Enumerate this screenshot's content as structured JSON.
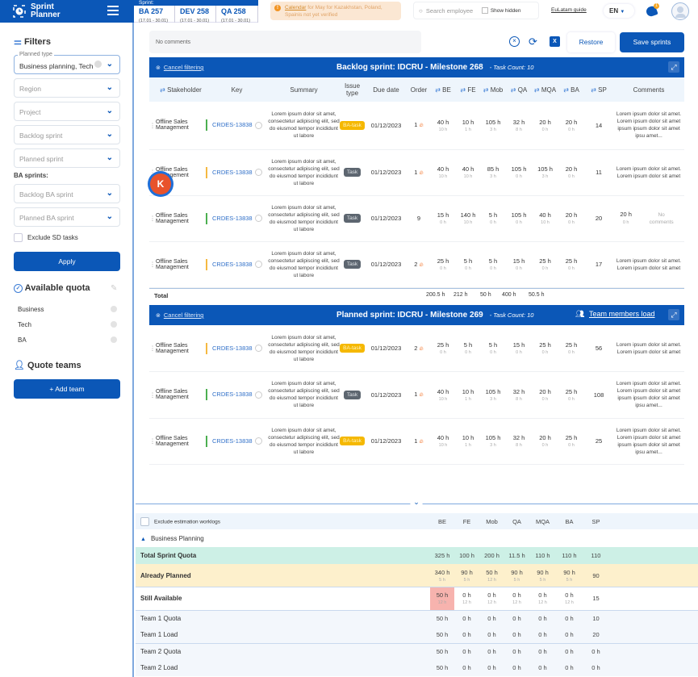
{
  "app": {
    "title_line1": "Sprint",
    "title_line2": "Planner"
  },
  "sprint_tabs": {
    "label": "Sprint:",
    "tabs": [
      {
        "name": "BA 257",
        "dates": "(17.01 - 30.01)"
      },
      {
        "name": "DEV 258",
        "dates": "(17.01 - 30.01)"
      },
      {
        "name": "QA 258",
        "dates": "(17.01 - 30.01)"
      }
    ]
  },
  "alert": {
    "link": "Calendar",
    "text": " for May for Kazakhstan, Poland, Spainis not yet verified"
  },
  "topbar": {
    "search_placeholder": "Search employee",
    "show_hidden": "Show hidden",
    "guide": "EuLatam guide",
    "lang": "EN",
    "bell_count": "1"
  },
  "sidebar": {
    "filters_title": "Filters",
    "planned_type_label": "Planned type",
    "planned_type_value": "Business planning, Tech",
    "region": "Region",
    "project": "Project",
    "backlog_sprint": "Backlog sprint",
    "planned_sprint": "Planned sprint",
    "ba_sprints": "BA sprints:",
    "backlog_ba": "Backlog BA sprint",
    "planned_ba": "Planned BA sprint",
    "exclude_sd": "Exclude SD tasks",
    "apply": "Apply",
    "quota_title": "Available quota",
    "quota_items": [
      "Business",
      "Tech",
      "BA"
    ],
    "teams_title": "Quote teams",
    "add_team": "+ Add team"
  },
  "toolbar": {
    "comments": "No comments",
    "restore": "Restore",
    "save": "Save sprints"
  },
  "columns": [
    "Stakeholder",
    "Key",
    "Summary",
    "Issue type",
    "Due date",
    "Order",
    "BE",
    "FE",
    "Mob",
    "QA",
    "MQA",
    "BA",
    "SP",
    "Comments"
  ],
  "colors": {
    "brand": "#0b57b7",
    "green": "#4caf50",
    "orange": "#f5b942"
  },
  "backlog": {
    "cancel": "Cancel filtering",
    "title": "Backlog sprint: IDCRU - Milestone 268",
    "task_count": "- Task Count: 10",
    "rows": [
      {
        "stakeholder": "Offline Sales Management",
        "key": "CRDES-13838",
        "bar": "green",
        "summary": "Lorem ipsum dolor sit amet, consectetur adipiscing elit, sed do eiusmod tempor incididunt ut labore",
        "type": "BA-task",
        "due": "01/12/2023",
        "order": "1",
        "fire": true,
        "h": [
          [
            "40 h",
            "10 h"
          ],
          [
            "10 h",
            "1 h"
          ],
          [
            "105 h",
            "3 h"
          ],
          [
            "32 h",
            "8 h"
          ],
          [
            "20 h",
            "0 h"
          ],
          [
            "20 h",
            "0 h"
          ]
        ],
        "sp": "14",
        "comment": "Lorem ipsum dolor sit amet. Lorem ipsum dolor sit amet  ipsum ipsum dolor sit amet ipsu amet..."
      },
      {
        "stakeholder": "Offline Sales Management",
        "key": "CRDES-13838",
        "bar": "orange",
        "summary": "Lorem ipsum dolor sit amet, consectetur adipiscing elit, sed do eiusmod tempor incididunt ut labore",
        "type": "Task",
        "due": "01/12/2023",
        "order": "1",
        "fire": true,
        "h": [
          [
            "40 h",
            "10 h"
          ],
          [
            "40 h",
            "10 h"
          ],
          [
            "85 h",
            "3 h"
          ],
          [
            "105 h",
            "0 h"
          ],
          [
            "105 h",
            "3 h"
          ],
          [
            "20 h",
            "0 h"
          ]
        ],
        "sp": "11",
        "comment": "Lorem ipsum dolor sit amet. Lorem ipsum dolor sit amet"
      },
      {
        "stakeholder": "Offline Sales Management",
        "key": "CRDES-13838",
        "bar": "green",
        "summary": "Lorem ipsum dolor sit amet, consectetur adipiscing elit, sed do eiusmod tempor incididunt ut labore",
        "type": "Task",
        "due": "01/12/2023",
        "order": "9",
        "fire": false,
        "h": [
          [
            "15 h",
            "0 h"
          ],
          [
            "140 h",
            "10 h"
          ],
          [
            "5 h",
            "0 h"
          ],
          [
            "105 h",
            "0 h"
          ],
          [
            "40 h",
            "10 h"
          ],
          [
            "20 h",
            "0 h"
          ]
        ],
        "sp": "20",
        "extra": [
          "20 h",
          "0 h"
        ],
        "comment": "No comments"
      },
      {
        "stakeholder": "Offline Sales Management",
        "key": "CRDES-13838",
        "bar": "orange",
        "summary": "Lorem ipsum dolor sit amet, consectetur adipiscing elit, sed do eiusmod tempor incididunt ut labore",
        "type": "Task",
        "due": "01/12/2023",
        "order": "2",
        "fire": true,
        "h": [
          [
            "25 h",
            "0 h"
          ],
          [
            "5 h",
            "0 h"
          ],
          [
            "5 h",
            "0 h"
          ],
          [
            "15 h",
            "0 h"
          ],
          [
            "25 h",
            "0 h"
          ],
          [
            "25 h",
            "0 h"
          ]
        ],
        "sp": "17",
        "comment": "Lorem ipsum dolor sit amet. Lorem ipsum dolor sit amet"
      }
    ],
    "total_label": "Total",
    "totals": [
      "200.5 h",
      "212 h",
      "50 h",
      "400 h",
      "50.5 h"
    ]
  },
  "planned": {
    "cancel": "Cancel filtering",
    "title": "Planned sprint: IDCRU - Milestone 269",
    "task_count": "- Task Count: 10",
    "team_load": "Team members load",
    "rows": [
      {
        "stakeholder": "Offline Sales Management",
        "key": "CRDES-13838",
        "bar": "orange",
        "summary": "Lorem ipsum dolor sit amet, consectetur adipiscing elit, sed do eiusmod tempor incididunt ut labore",
        "type": "BA-task",
        "due": "01/12/2023",
        "order": "2",
        "fire": true,
        "h": [
          [
            "25 h",
            "0 h"
          ],
          [
            "5 h",
            "0 h"
          ],
          [
            "5 h",
            "0 h"
          ],
          [
            "15 h",
            "0 h"
          ],
          [
            "25 h",
            "0 h"
          ],
          [
            "25 h",
            "0 h"
          ]
        ],
        "sp": "56",
        "comment": "Lorem ipsum dolor sit amet. Lorem ipsum dolor sit amet"
      },
      {
        "stakeholder": "Offline Sales Management",
        "key": "CRDES-13838",
        "bar": "green",
        "summary": "Lorem ipsum dolor sit amet, consectetur adipiscing elit, sed do eiusmod tempor incididunt ut labore",
        "type": "Task",
        "due": "01/12/2023",
        "order": "1",
        "fire": true,
        "h": [
          [
            "40 h",
            "10 h"
          ],
          [
            "10 h",
            "1 h"
          ],
          [
            "105 h",
            "3 h"
          ],
          [
            "32 h",
            "8 h"
          ],
          [
            "20 h",
            "0 h"
          ],
          [
            "25 h",
            "0 h"
          ]
        ],
        "sp": "108",
        "comment": "Lorem ipsum dolor sit amet. Lorem ipsum dolor sit amet  ipsum ipsum dolor sit amet ipsu amet..."
      },
      {
        "stakeholder": "Offline Sales Management",
        "key": "CRDES-13838",
        "bar": "green",
        "summary": "Lorem ipsum dolor sit amet, consectetur adipiscing elit, sed do eiusmod tempor incididunt ut labore",
        "type": "BA-task",
        "due": "01/12/2023",
        "order": "1",
        "fire": true,
        "h": [
          [
            "40 h",
            "10 h"
          ],
          [
            "10 h",
            "1 h"
          ],
          [
            "105 h",
            "3 h"
          ],
          [
            "32 h",
            "8 h"
          ],
          [
            "20 h",
            "0 h"
          ],
          [
            "25 h",
            "0 h"
          ]
        ],
        "sp": "25",
        "comment": "Lorem ipsum dolor sit amet. Lorem ipsum dolor sit amet  ipsum ipsum dolor sit amet ipsu amet..."
      }
    ]
  },
  "quota": {
    "exclude": "Exclude estimation worklogs",
    "columns": [
      "BE",
      "FE",
      "Mob",
      "QA",
      "MQA",
      "BA",
      "SP"
    ],
    "group": "Business Planning",
    "rows": [
      {
        "label": "Total Sprint Quota",
        "style": "green",
        "cells": [
          [
            "325 h"
          ],
          [
            "100 h"
          ],
          [
            "200 h"
          ],
          [
            "11.5 h"
          ],
          [
            "110 h"
          ],
          [
            "110 h"
          ],
          [
            "110"
          ]
        ]
      },
      {
        "label": "Already Planned",
        "style": "yellow",
        "cells": [
          [
            "340 h",
            "5 h"
          ],
          [
            "90 h",
            "5 h"
          ],
          [
            "50 h",
            "12 h"
          ],
          [
            "90 h",
            "5 h"
          ],
          [
            "90 h",
            "5 h"
          ],
          [
            "90 h",
            "5 h"
          ],
          [
            "90"
          ]
        ]
      },
      {
        "label": "Still Available",
        "style": "white",
        "over": [
          0
        ],
        "cells": [
          [
            "50 h",
            "12 h"
          ],
          [
            "0 h",
            "12 h"
          ],
          [
            "0 h",
            "12 h"
          ],
          [
            "0 h",
            "12 h"
          ],
          [
            "0 h",
            "12 h"
          ],
          [
            "0 h",
            "12 h"
          ],
          [
            "15"
          ]
        ]
      },
      {
        "label": "Team 1 Quota",
        "style": "team",
        "cells": [
          [
            "50 h"
          ],
          [
            "0 h"
          ],
          [
            "0 h"
          ],
          [
            "0 h"
          ],
          [
            "0 h"
          ],
          [
            "0 h"
          ],
          [
            "10"
          ]
        ]
      },
      {
        "label": "Team 1 Load",
        "style": "team",
        "cells": [
          [
            "50 h"
          ],
          [
            "0 h"
          ],
          [
            "0 h"
          ],
          [
            "0 h"
          ],
          [
            "0 h"
          ],
          [
            "0 h"
          ],
          [
            "20"
          ]
        ]
      },
      {
        "label": "Team 2 Quota",
        "style": "team",
        "cells": [
          [
            "50 h"
          ],
          [
            "0 h"
          ],
          [
            "0 h"
          ],
          [
            "0 h"
          ],
          [
            "0 h"
          ],
          [
            "0 h"
          ],
          [
            "0 h"
          ]
        ]
      },
      {
        "label": "Team 2 Load",
        "style": "team",
        "cells": [
          [
            "50 h"
          ],
          [
            "0 h"
          ],
          [
            "0 h"
          ],
          [
            "0 h"
          ],
          [
            "0 h"
          ],
          [
            "0 h"
          ],
          [
            "0 h"
          ]
        ]
      }
    ]
  },
  "floating_avatar": {
    "letter": "K"
  }
}
